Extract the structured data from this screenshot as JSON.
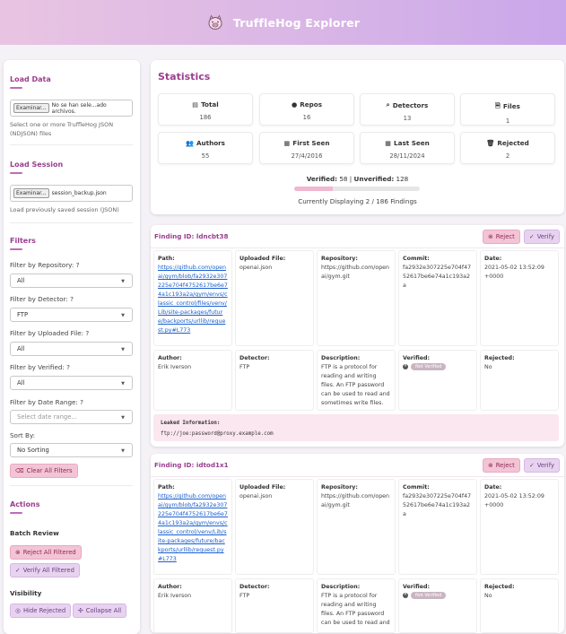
{
  "header": {
    "title": "TruffleHog Explorer"
  },
  "sidebar": {
    "load_data": {
      "title": "Load Data",
      "file_button": "Examinar...",
      "file_text": "No se han sele...ado archivos.",
      "note": "Select one or more TruffleHog JSON (NDJSON) files"
    },
    "load_session": {
      "title": "Load Session",
      "file_button": "Examinar...",
      "file_text": "session_backup.json",
      "note": "Load previously saved session (JSON)"
    },
    "filters": {
      "title": "Filters",
      "repo": {
        "label": "Filter by Repository:",
        "help": "?",
        "value": "All"
      },
      "detector": {
        "label": "Filter by Detector:",
        "help": "?",
        "value": "FTP"
      },
      "uploaded": {
        "label": "Filter by Uploaded File:",
        "help": "?",
        "value": "All"
      },
      "verified": {
        "label": "Filter by Verified:",
        "help": "?",
        "value": "All"
      },
      "date": {
        "label": "Filter by Date Range:",
        "help": "?",
        "placeholder": "Select date range..."
      },
      "sort": {
        "label": "Sort By:",
        "value": "No Sorting"
      },
      "clear": "Clear All Filters"
    },
    "actions": {
      "title": "Actions",
      "batch_title": "Batch Review",
      "reject_all": "Reject All Filtered",
      "verify_all": "Verify All Filtered",
      "visibility_title": "Visibility",
      "hide_rejected": "Hide Rejected",
      "collapse_all": "Collapse All"
    }
  },
  "stats": {
    "title": "Statistics",
    "cards": [
      {
        "label": "Total",
        "value": "186",
        "icon": "list-icon"
      },
      {
        "label": "Repos",
        "value": "16",
        "icon": "github-icon"
      },
      {
        "label": "Detectors",
        "value": "13",
        "icon": "search-icon"
      },
      {
        "label": "Files",
        "value": "1",
        "icon": "file-icon"
      },
      {
        "label": "Authors",
        "value": "55",
        "icon": "users-icon"
      },
      {
        "label": "First Seen",
        "value": "27/4/2016",
        "icon": "calendar-icon"
      },
      {
        "label": "Last Seen",
        "value": "28/11/2024",
        "icon": "calendar-check-icon"
      },
      {
        "label": "Rejected",
        "value": "2",
        "icon": "trash-icon"
      }
    ],
    "verified_label": "Verified:",
    "verified_value": "58",
    "sep": "|",
    "unverified_label": "Unverified:",
    "unverified_value": "128",
    "progress_fraction": 0.31,
    "displaying": "Currently Displaying 2 / 186 Findings"
  },
  "findings": [
    {
      "id": "Finding ID: ldncbt38",
      "reject": "Reject",
      "verify": "Verify",
      "path_label": "Path:",
      "path": "https://github.com/openai/gym/blob/fa2932e307225e704f4752617be6e74a1c193a2a/gym/envs/classic_control/files/venv/Lib/site-packages/future/backports/urllib/request.py#L773",
      "uploaded_label": "Uploaded File:",
      "uploaded": "openai.json",
      "repo_label": "Repository:",
      "repo": "https://github.com/openai/gym.git",
      "commit_label": "Commit:",
      "commit": "fa2932e307225e704f4752617be6e74a1c193a2a",
      "date_label": "Date:",
      "date": "2021-05-02 13:52:09 +0000",
      "author_label": "Author:",
      "author": "Erik Iverson",
      "detector_label": "Detector:",
      "detector": "FTP",
      "desc_label": "Description:",
      "desc": "FTP is a protocol for reading and writing files. An FTP password can be used to read and sometimes write files.",
      "verified_label": "Verified:",
      "verified": "Not Verified",
      "rejected_label": "Rejected:",
      "rejected": "No",
      "leak_label": "Leaked Information:",
      "leak": "ftp://joe:password@proxy.example.com"
    },
    {
      "id": "Finding ID: idtod1x1",
      "reject": "Reject",
      "verify": "Verify",
      "path_label": "Path:",
      "path": "https://github.com/openai/gym/blob/fa2932e307225e704f4752617be6e74a1c193a2a/gym/envs/classic_control/venv/Lib/site-packages/future/backports/urllib/request.py#L773",
      "uploaded_label": "Uploaded File:",
      "uploaded": "openai.json",
      "repo_label": "Repository:",
      "repo": "https://github.com/openai/gym.git",
      "commit_label": "Commit:",
      "commit": "fa2932e307225e704f4752617be6e74a1c193a2a",
      "date_label": "Date:",
      "date": "2021-05-02 13:52:09 +0000",
      "author_label": "Author:",
      "author": "Erik Iverson",
      "detector_label": "Detector:",
      "detector": "FTP",
      "desc_label": "Description:",
      "desc": "FTP is a protocol for reading and writing files. An FTP password can be used to read and",
      "verified_label": "Verified:",
      "verified": "Not Verified",
      "rejected_label": "Rejected:",
      "rejected": "No"
    }
  ]
}
